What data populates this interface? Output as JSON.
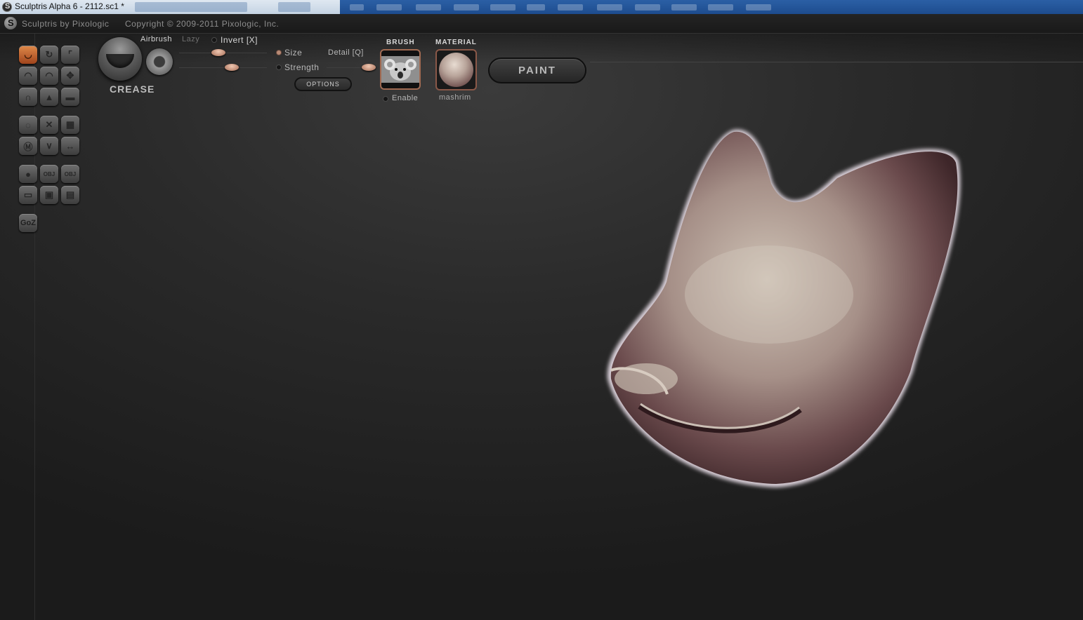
{
  "window": {
    "title": "Sculptris Alpha 6 - 2112.sc1 *"
  },
  "header": {
    "app_name": "Sculptris by Pixologic",
    "copyright": "Copyright © 2009-2011 Pixologic, Inc."
  },
  "tools": [
    {
      "name": "crease-tool",
      "icon": "crease-icon",
      "glyph": "◡",
      "active": true
    },
    {
      "name": "rotate-tool",
      "icon": "rotate-icon",
      "glyph": "↻"
    },
    {
      "name": "scale-tool",
      "icon": "crop-scale-icon",
      "glyph": "⌜"
    },
    {
      "name": "draw-tool",
      "icon": "mound-icon",
      "glyph": "◠"
    },
    {
      "name": "inflate-tool",
      "icon": "inflate-icon",
      "glyph": "◠"
    },
    {
      "name": "grab-tool",
      "icon": "move-arrows-icon",
      "glyph": "✥"
    },
    {
      "name": "pinch-tool",
      "icon": "pinch-icon",
      "glyph": "∩"
    },
    {
      "name": "flatten-tool",
      "icon": "flatten-icon",
      "glyph": "▲"
    },
    {
      "name": "smooth-tool",
      "icon": "smooth-icon",
      "glyph": "▬"
    },
    {
      "name": "reduce-brush-tool",
      "icon": "reduce-icon",
      "glyph": "◌"
    },
    {
      "name": "reduce-selected-tool",
      "icon": "reduce-x-icon",
      "glyph": "✕"
    },
    {
      "name": "subdivide-tool",
      "icon": "grid-icon",
      "glyph": "▦"
    },
    {
      "name": "mask-tool",
      "icon": "mask-icon",
      "glyph": "Ⓜ"
    },
    {
      "name": "symmetry-tool",
      "icon": "symmetry-icon",
      "glyph": "∨"
    },
    {
      "name": "mirror-tool",
      "icon": "mirror-arrows-icon",
      "glyph": "↔"
    },
    {
      "name": "new-sphere-tool",
      "icon": "sphere-icon",
      "glyph": "●"
    },
    {
      "name": "import-obj-tool",
      "icon": "obj-import-icon",
      "glyph": "OBJ"
    },
    {
      "name": "export-obj-tool",
      "icon": "obj-export-icon",
      "glyph": "OBJ"
    },
    {
      "name": "new-plane-tool",
      "icon": "plane-icon",
      "glyph": "▭"
    },
    {
      "name": "open-tool",
      "icon": "open-file-icon",
      "glyph": "▣"
    },
    {
      "name": "save-tool",
      "icon": "save-file-icon",
      "glyph": "▤"
    },
    {
      "name": "goz-tool",
      "icon": "goz-icon",
      "glyph": "GoZ"
    }
  ],
  "brush_panel": {
    "brush_name": "CREASE",
    "airbrush_label": "Airbrush",
    "lazy_label": "Lazy",
    "invert_label": "Invert [X]",
    "size_label": "Size",
    "strength_label": "Strength",
    "detail_label": "Detail [Q]",
    "options_label": "OPTIONS",
    "size_value": 0.45,
    "strength_value": 0.6,
    "detail_value": 0.85
  },
  "brush_texture": {
    "title": "BRUSH",
    "enable_label": "Enable"
  },
  "material": {
    "title": "MATERIAL",
    "name": "mashrim"
  },
  "paint_button": {
    "label": "PAINT"
  },
  "colors": {
    "accent": "#d9743a",
    "slider_knob": "#e0ad95",
    "background": "#2a2a2a"
  }
}
